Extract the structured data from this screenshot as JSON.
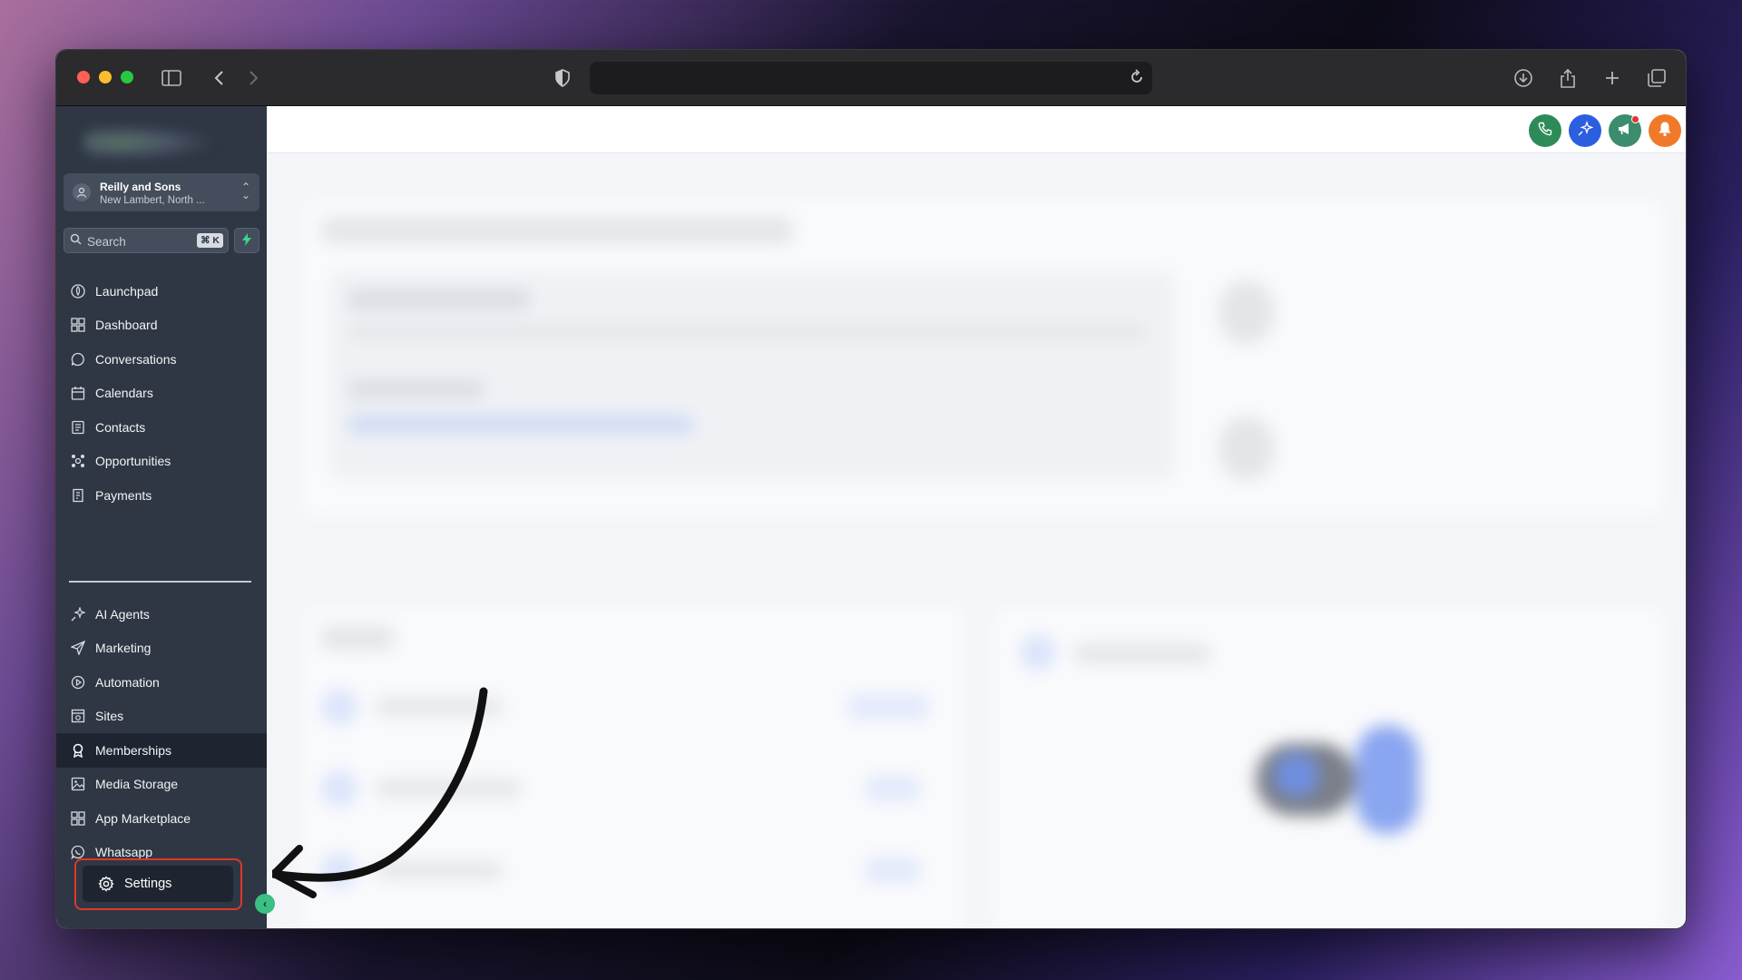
{
  "account": {
    "name": "Reilly and Sons",
    "location": "New Lambert, North ..."
  },
  "search": {
    "placeholder": "Search",
    "shortcut": "⌘ K"
  },
  "nav": {
    "primary": [
      {
        "label": "Launchpad",
        "icon": "rocket-icon"
      },
      {
        "label": "Dashboard",
        "icon": "grid-icon"
      },
      {
        "label": "Conversations",
        "icon": "chat-icon"
      },
      {
        "label": "Calendars",
        "icon": "calendar-icon"
      },
      {
        "label": "Contacts",
        "icon": "contacts-icon"
      },
      {
        "label": "Opportunities",
        "icon": "opportunities-icon"
      },
      {
        "label": "Payments",
        "icon": "payments-icon"
      }
    ],
    "secondary": [
      {
        "label": "AI Agents",
        "icon": "sparkles-icon"
      },
      {
        "label": "Marketing",
        "icon": "send-icon"
      },
      {
        "label": "Automation",
        "icon": "automation-icon"
      },
      {
        "label": "Sites",
        "icon": "sites-icon"
      },
      {
        "label": "Memberships",
        "icon": "award-icon",
        "active": true
      },
      {
        "label": "Media Storage",
        "icon": "image-icon"
      },
      {
        "label": "App Marketplace",
        "icon": "apps-icon"
      },
      {
        "label": "Whatsapp",
        "icon": "whatsapp-icon"
      }
    ]
  },
  "settings": {
    "label": "Settings",
    "icon": "gear-icon"
  },
  "topbar": {
    "buttons": [
      {
        "icon": "phone-icon",
        "color": "#2e8b57"
      },
      {
        "icon": "sparkle-icon",
        "color": "#2c5ee0"
      },
      {
        "icon": "megaphone-icon",
        "color": "#3c8c6e"
      },
      {
        "icon": "bell-icon",
        "color": "#f07a2a"
      },
      {
        "icon": "help-icon",
        "color": "#3b82f6",
        "label": "?"
      }
    ]
  },
  "colors": {
    "sidebar_bg": "#2f3744",
    "active_bg": "#1f2530",
    "highlight_outline": "#e0362c",
    "accent_green": "#3bbf83"
  }
}
